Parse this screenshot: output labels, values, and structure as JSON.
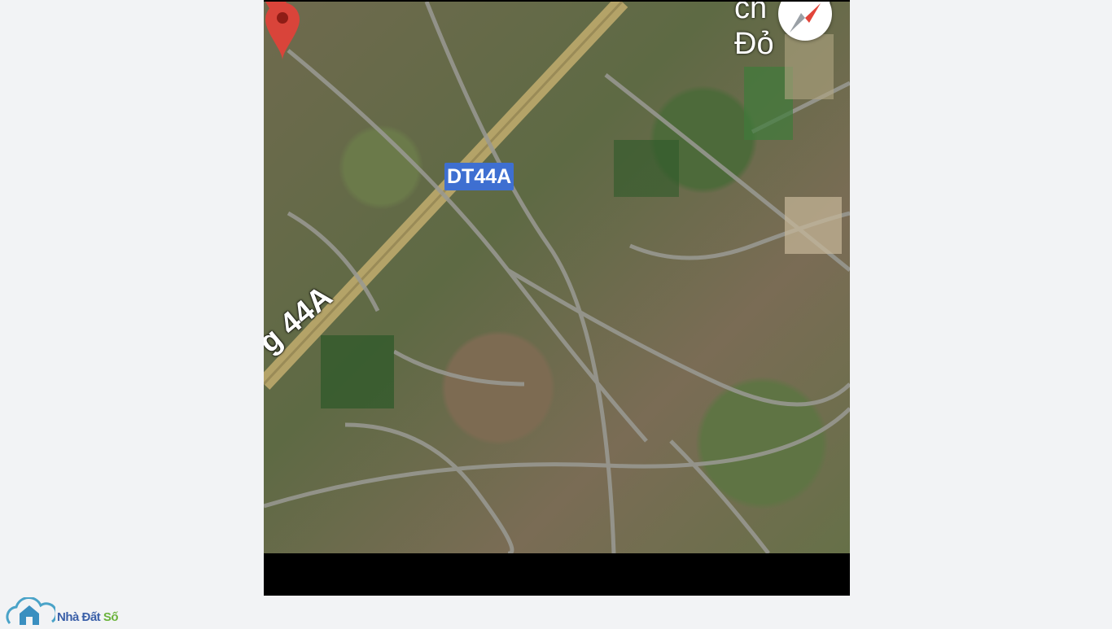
{
  "map": {
    "route_badge": "DT44A",
    "route_curved_text": "g 44A",
    "place_label": "ch     H\nĐỏ",
    "view": "satellite",
    "marker_color": "#d9443a",
    "badge_color": "#3e6fd1",
    "compass_icon": "compass-needle",
    "marker_icon": "location-pin"
  },
  "watermark": {
    "name_part1": "Nhà Đất ",
    "name_part2": "Số",
    "icon": "house-cloud-logo",
    "color_primary": "#3a5fa8",
    "color_accent": "#6bb33b"
  }
}
